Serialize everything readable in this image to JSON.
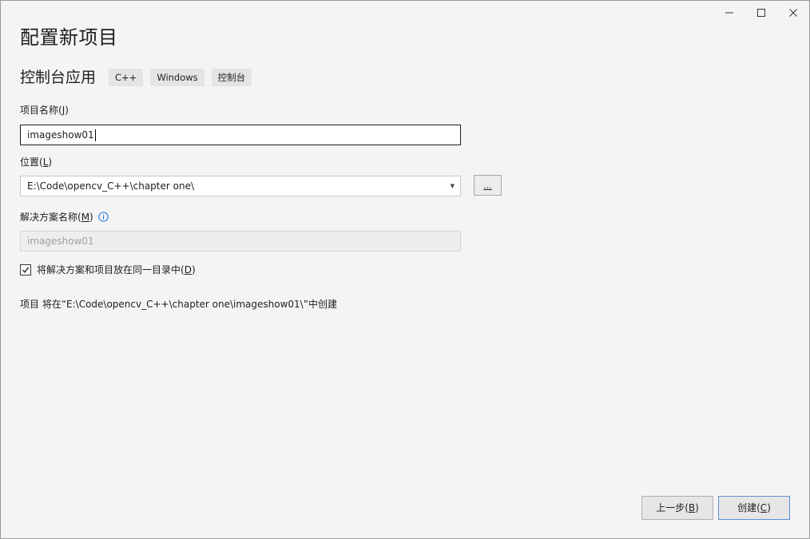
{
  "window": {
    "title": "配置新项目",
    "controls": {
      "minimize_icon": "minimize-icon",
      "maximize_icon": "maximize-icon",
      "close_icon": "close-icon"
    }
  },
  "template": {
    "name": "控制台应用",
    "tags": [
      "C++",
      "Windows",
      "控制台"
    ]
  },
  "project_name": {
    "label": "项目名称(",
    "access_key": "J",
    "label_end": ")",
    "value": "imageshow01"
  },
  "location": {
    "label": "位置(",
    "access_key": "L",
    "label_end": ")",
    "value": "E:\\Code\\opencv_C++\\chapter one\\",
    "browse_label": "..."
  },
  "solution_name": {
    "label": "解决方案名称(",
    "access_key": "M",
    "label_end": ")",
    "value": "imageshow01"
  },
  "same_directory": {
    "label": "将解决方案和项目放在同一目录中(",
    "access_key": "D",
    "label_end": ")",
    "checked": true
  },
  "summary": "项目 将在“E:\\Code\\opencv_C++\\chapter one\\imageshow01\\”中创建",
  "buttons": {
    "back": "上一步(",
    "back_key": "B",
    "back_end": ")",
    "create": "创建(",
    "create_key": "C",
    "create_end": ")"
  },
  "colors": {
    "accent": "#1e6fd9",
    "primary_border": "#5b8fd6"
  }
}
